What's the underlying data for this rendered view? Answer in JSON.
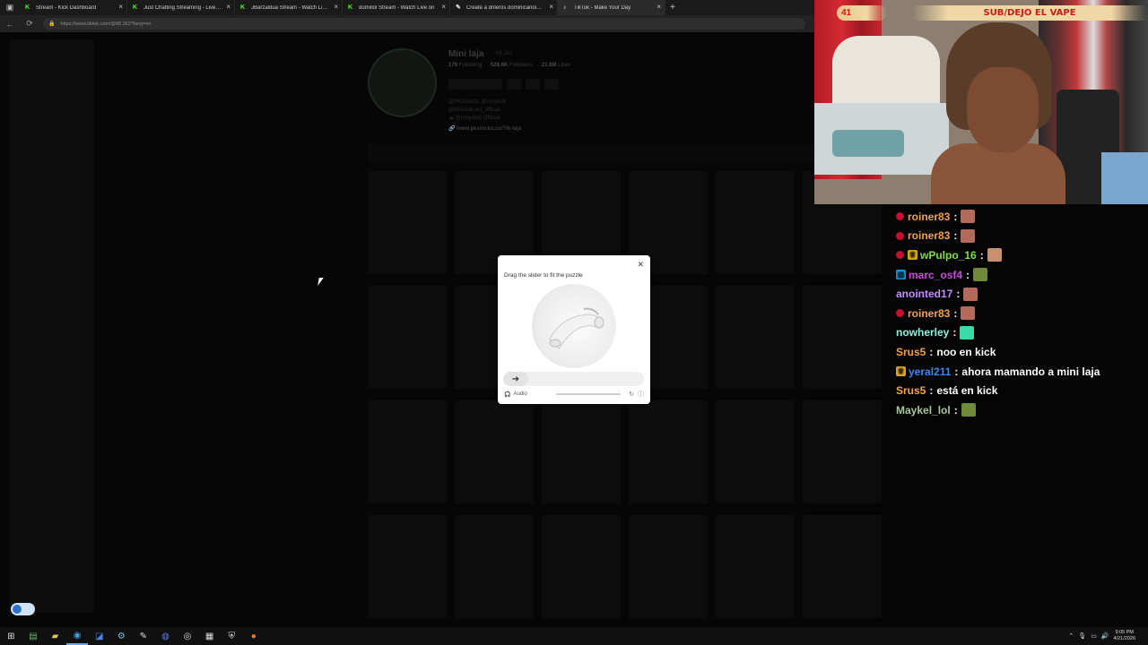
{
  "browser": {
    "tabs": [
      {
        "label": "Stream - Kick Dashboard",
        "favicon": "kick",
        "active": false
      },
      {
        "label": "Just Chatting Streaming - Live St",
        "favicon": "kick",
        "active": false
      },
      {
        "label": "JBarzaldua Stream - Watch Live on",
        "favicon": "kick",
        "active": false
      },
      {
        "label": "domiilol Stream - Watch Live on",
        "favicon": "kick",
        "active": false
      },
      {
        "label": "Create a dnleros dominicanois 20",
        "favicon": "other",
        "active": false
      },
      {
        "label": "TikTok - Make Your Day",
        "favicon": "tiktok",
        "active": true
      }
    ],
    "url": "https://www.tiktok.com/@88.362?lang=en"
  },
  "profile": {
    "name": "Mini laja",
    "handle": "88.362",
    "stats": [
      {
        "value": "179",
        "label": "Following"
      },
      {
        "value": "528.6K",
        "label": "Followers"
      },
      {
        "value": "21.8M",
        "label": "Likes"
      }
    ],
    "bio": [
      "@PKStockX, @rucykick",
      "@kickclub.net_official",
      "☁ @Ling.kick Official"
    ],
    "link": "🔗 www.pkstocks.cc/?/k-laja"
  },
  "captcha": {
    "title": "Drag the slider to fit the puzzle",
    "audio_label": "Audio",
    "slider_progress": 0
  },
  "stream": {
    "counter": "41",
    "banner": "SUB/DEJO EL VAPE"
  },
  "chat": [
    {
      "user": "roiner83",
      "color": "#f6a14b",
      "badge": "dot",
      "message": "",
      "emote": "#b36a5a"
    },
    {
      "user": "roiner83",
      "color": "#f6a14b",
      "badge": "dot",
      "message": "",
      "emote": "#b36a5a"
    },
    {
      "user": "wPulpo_16",
      "color": "#7fe23a",
      "badge": "dot-sq",
      "message": "",
      "emote": "#c9906e"
    },
    {
      "user": "marc_osf4",
      "color": "#c74ad8",
      "badge": "sq-blue",
      "message": "",
      "emote": "#6f8a3a"
    },
    {
      "user": "anointed17",
      "color": "#c58cff",
      "badge": "",
      "message": "",
      "emote": "#b36a5a"
    },
    {
      "user": "roiner83",
      "color": "#f6a14b",
      "badge": "dot",
      "message": "",
      "emote": "#b36a5a"
    },
    {
      "user": "nowherley",
      "color": "#8ff0e0",
      "badge": "",
      "message": "",
      "emote": "#3fd8a8"
    },
    {
      "user": "Srus5",
      "color": "#f6a14b",
      "badge": "",
      "message": "noo en kick",
      "emote": ""
    },
    {
      "user": "yeral211",
      "color": "#3a8cf0",
      "badge": "sq",
      "message": "ahora mamando a mini laja",
      "emote": ""
    },
    {
      "user": "Srus5",
      "color": "#f6a14b",
      "badge": "",
      "message": "está en kick",
      "emote": ""
    },
    {
      "user": "Maykel_lol",
      "color": "#a8c89a",
      "badge": "",
      "message": "",
      "emote": "#6f8a3a"
    }
  ],
  "taskbar": {
    "time": "9:05 PM",
    "date": "4/21/2026"
  }
}
